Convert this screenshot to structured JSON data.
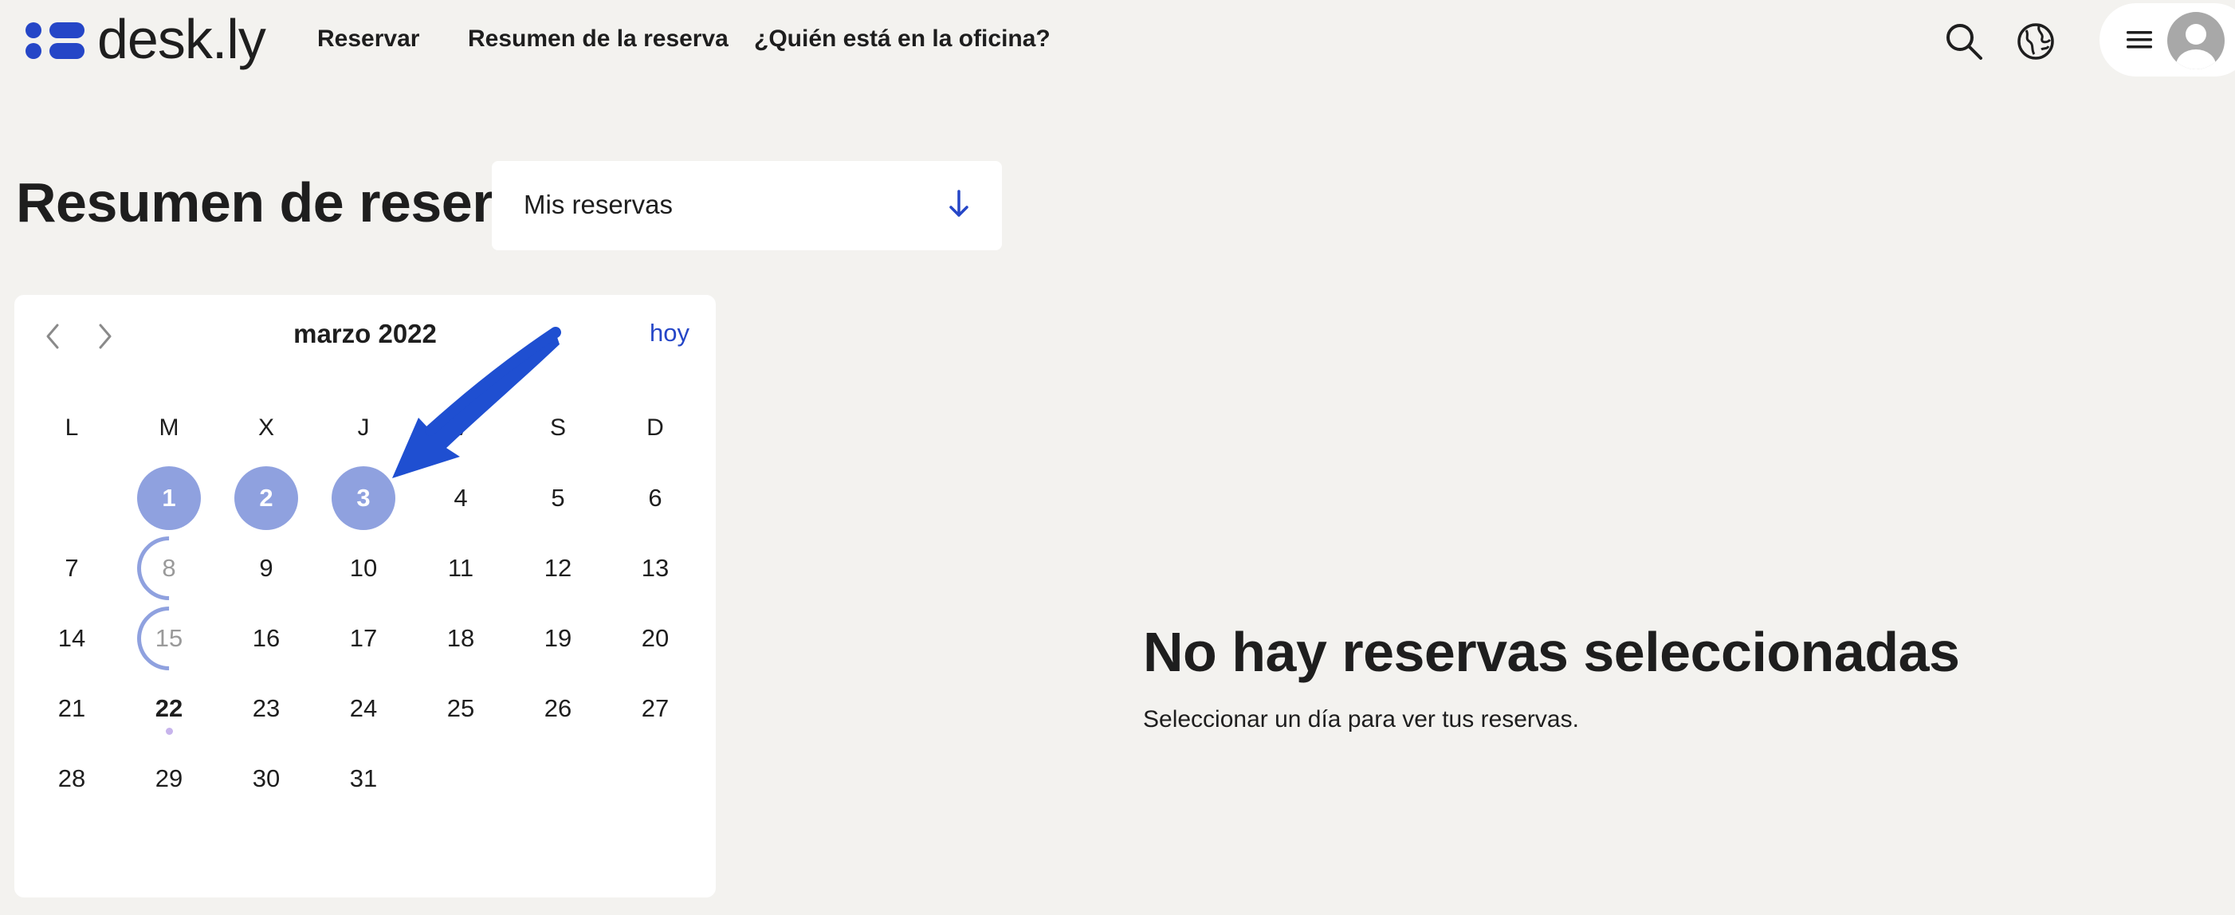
{
  "app": {
    "brand": "desk.ly",
    "accent_color": "#2546c7",
    "booked_color": "#8fa1df"
  },
  "nav": {
    "items": [
      {
        "label": "Reservar"
      },
      {
        "label": "Resumen de la reserva"
      },
      {
        "label": "¿Quién está en la oficina?"
      }
    ],
    "icons": [
      "search-icon",
      "globe-icon",
      "menu-icon",
      "avatar-icon"
    ]
  },
  "page": {
    "title": "Resumen de reserva"
  },
  "filter": {
    "value": "Mis reservas",
    "icon": "arrow-down-icon"
  },
  "calendar": {
    "month": "marzo 2022",
    "today_label": "hoy",
    "weekdays": [
      "L",
      "M",
      "X",
      "J",
      "V",
      "S",
      "D"
    ],
    "weeks": [
      [
        "",
        "1",
        "2",
        "3",
        "4",
        "5",
        "6"
      ],
      [
        "7",
        "8",
        "9",
        "10",
        "11",
        "12",
        "13"
      ],
      [
        "14",
        "15",
        "16",
        "17",
        "18",
        "19",
        "20"
      ],
      [
        "21",
        "22",
        "23",
        "24",
        "25",
        "26",
        "27"
      ],
      [
        "28",
        "29",
        "30",
        "31",
        "",
        "",
        ""
      ]
    ],
    "booked_days": [
      "1",
      "2",
      "3"
    ],
    "partial_days": [
      "8",
      "15"
    ],
    "today": "22"
  },
  "empty_state": {
    "title": "No hay reservas seleccionadas",
    "subtitle": "Seleccionar un día para ver tus reservas."
  }
}
